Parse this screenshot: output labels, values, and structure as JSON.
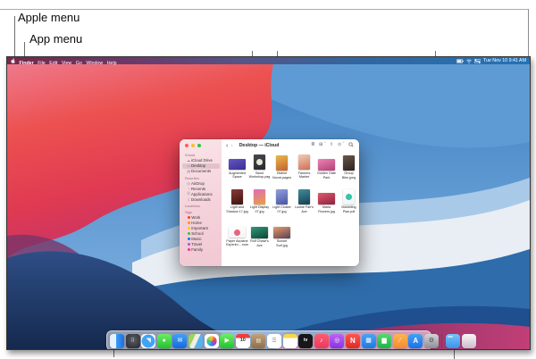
{
  "figure": {
    "labels": [
      {
        "id": "apple-menu",
        "text": "Apple menu"
      },
      {
        "id": "app-menu",
        "text": "App menu"
      }
    ]
  },
  "menu_bar": {
    "app_menus": [
      "Finder",
      "File",
      "Edit",
      "View",
      "Go",
      "Window",
      "Help"
    ],
    "status": {
      "icons": [
        "battery-icon",
        "wifi-icon",
        "control-center-icon"
      ],
      "datetime": "Tue Nov 10  9:41 AM"
    }
  },
  "finder_window": {
    "title": "Desktop — iCloud",
    "toolbar": {
      "back": "‹",
      "forward": "›",
      "icons": [
        {
          "name": "view-icon",
          "glyph": "≣"
        },
        {
          "name": "group-icon",
          "glyph": "⊞ ˇ"
        },
        {
          "name": "share-icon",
          "glyph": "⇧"
        },
        {
          "name": "more-icon",
          "glyph": "⊙ ˇ"
        },
        {
          "name": "search-icon",
          "glyph": "svg"
        }
      ]
    },
    "sidebar": {
      "sections": [
        {
          "header": "iCloud",
          "items": [
            {
              "label": "iCloud Drive",
              "icon": "cloud-icon"
            },
            {
              "label": "Desktop",
              "icon": "desktop-icon",
              "selected": true
            },
            {
              "label": "Documents",
              "icon": "documents-icon"
            }
          ]
        },
        {
          "header": "Favorites",
          "items": [
            {
              "label": "AirDrop",
              "icon": "airdrop-icon"
            },
            {
              "label": "Recents",
              "icon": "recents-icon"
            },
            {
              "label": "Applications",
              "icon": "applications-icon"
            },
            {
              "label": "Downloads",
              "icon": "downloads-icon"
            }
          ]
        },
        {
          "header": "Locations",
          "items": []
        },
        {
          "header": "Tags",
          "items": [
            {
              "label": "Work",
              "dot": "#ff3b30"
            },
            {
              "label": "Home",
              "dot": "#ff9500"
            },
            {
              "label": "Important",
              "dot": "#ffcc00"
            },
            {
              "label": "School",
              "dot": "#28c840"
            },
            {
              "label": "Music",
              "dot": "#007aff"
            },
            {
              "label": "Travel",
              "dot": "#af52de"
            },
            {
              "label": "Family",
              "dot": "#ff2d92"
            }
          ]
        }
      ]
    },
    "files": [
      {
        "name": "Augmented Space Reimagined.key",
        "thumb": {
          "o": "l",
          "c1": "#6456c8",
          "c2": "#3b2f8e"
        }
      },
      {
        "name": "Band Workshop.pages",
        "thumb": {
          "o": "p",
          "c1": "#4a4a4e",
          "c2": "#28282c",
          "accent": "#e9e5da"
        }
      },
      {
        "name": "District Noord.pages",
        "thumb": {
          "o": "p",
          "c1": "#e8b84a",
          "c2": "#c2622e"
        }
      },
      {
        "name": "Farmers Market Monthly Planner.pdf",
        "thumb": {
          "o": "p",
          "c1": "#f0cdb8",
          "c2": "#cf6f52"
        }
      },
      {
        "name": "Golden Gate Park",
        "thumb": {
          "o": "l",
          "c1": "#ef82b4",
          "c2": "#b04277"
        }
      },
      {
        "name": "Group Bike.jpeg",
        "thumb": {
          "o": "p",
          "c1": "#6a5648",
          "c2": "#2e241e"
        }
      },
      {
        "name": "Light and Shadow 17.jpg",
        "thumb": {
          "o": "p",
          "c1": "#8a3a34",
          "c2": "#3a1512"
        }
      },
      {
        "name": "Light Display 07.jpg",
        "thumb": {
          "o": "p",
          "c1": "#e06ac0",
          "c2": "#e8a23a"
        }
      },
      {
        "name": "Light Cluster 07.jpg",
        "thumb": {
          "o": "p",
          "c1": "#8fa0dc",
          "c2": "#4a55a2"
        }
      },
      {
        "name": "Louise Fair's Ave",
        "thumb": {
          "o": "p",
          "c1": "#3f8ea0",
          "c2": "#173f4e"
        }
      },
      {
        "name": "Maria Flowers.jpg",
        "thumb": {
          "o": "l",
          "c1": "#e05a6a",
          "c2": "#8e2242"
        }
      },
      {
        "name": "Marketing Plan.pdf",
        "thumb": {
          "o": "p",
          "c1": "#ffffff",
          "c2": "#eef4f2",
          "accent": "#35c4a8"
        }
      },
      {
        "name": "Paper Airplane Experim....numbers",
        "thumb": {
          "o": "l",
          "c1": "#ffffff",
          "c2": "#f4f4f4",
          "accent": "#e8647e"
        }
      },
      {
        "name": "Rolf Chase's Ave",
        "thumb": {
          "o": "l",
          "c1": "#2f9a7a",
          "c2": "#114436"
        }
      },
      {
        "name": "Sunset Surf.jpg",
        "thumb": {
          "o": "l",
          "c1": "#e89a66",
          "c2": "#584058"
        }
      }
    ]
  },
  "dock": {
    "apps": [
      {
        "id": "finder",
        "name": "Finder",
        "bg": "linear-gradient(90deg,#e3f2fc 0%,#e3f2fc 44%,#3f9bf4 44%,#1b6fe0 100%)",
        "glyph": "",
        "fg": "#1b5fb0"
      },
      {
        "id": "launchpad",
        "name": "Launchpad",
        "bg": "radial-gradient(circle at 50% 40%,#5d5d66,#26262c)",
        "glyph": "⠿",
        "fg": "#d2d5de"
      },
      {
        "id": "safari",
        "name": "Safari",
        "bg": "radial-gradient(circle at 50% 50%,#3fa4f6 0%,#3fa4f6 64%,#f3f5f8 66%)",
        "glyph": "◥",
        "fg": "#f2f2f4"
      },
      {
        "id": "messages",
        "name": "Messages",
        "bg": "linear-gradient(180deg,#6ced63,#20c32f)",
        "glyph": "●",
        "fg": "#ffffff"
      },
      {
        "id": "mail",
        "name": "Mail",
        "bg": "linear-gradient(180deg,#41a1f5,#1468df)",
        "glyph": "✉",
        "fg": "#ffffff"
      },
      {
        "id": "maps",
        "name": "Maps",
        "bg": "linear-gradient(115deg,#9bd45f 0%,#9bd45f 34%,#f1eee2 34%,#f1eee2 58%,#57b1f1 58%)",
        "glyph": "",
        "fg": "#ffffff"
      },
      {
        "id": "photos",
        "name": "Photos",
        "bg": "radial-gradient(circle closest-side,rgba(255,255,255,0) 0%,rgba(255,255,255,0) 70%,#ffffff 72%),conic-gradient(#f6c23d,#f0643c,#cf3e84,#8e52d0,#3f77e8,#39b5e8,#43c26f,#a6d23f,#f6c23d)",
        "glyph": "",
        "fg": "#ffffff"
      },
      {
        "id": "facetime",
        "name": "FaceTime",
        "bg": "linear-gradient(180deg,#6ced63,#20c32f)",
        "glyph": "▶",
        "fg": "#ffffff"
      },
      {
        "id": "calendar",
        "name": "Calendar",
        "bg": "linear-gradient(180deg,#f23c3c 0%,#f23c3c 27%,#ffffff 27%)",
        "glyph": "10",
        "fg": "#333333"
      },
      {
        "id": "contacts",
        "name": "Contacts",
        "bg": "linear-gradient(180deg,#c3a077,#8c6f4e)",
        "glyph": "▤",
        "fg": "#f3e9d6"
      },
      {
        "id": "reminders",
        "name": "Reminders",
        "bg": "#ffffff",
        "glyph": "☰",
        "fg": "#8a8a90"
      },
      {
        "id": "notes",
        "name": "Notes",
        "bg": "linear-gradient(180deg,#f7d64a 0%,#f7d64a 28%,#ffffff 28%)",
        "glyph": "",
        "fg": "#999999"
      },
      {
        "id": "tv",
        "name": "TV",
        "bg": "#17171a",
        "glyph": "tv",
        "fg": "#ffffff"
      },
      {
        "id": "music",
        "name": "Music",
        "bg": "linear-gradient(180deg,#fc5c72,#ec3860)",
        "glyph": "♪",
        "fg": "#ffffff"
      },
      {
        "id": "podcasts",
        "name": "Podcasts",
        "bg": "linear-gradient(180deg,#c061f2,#8434e8)",
        "glyph": "◎",
        "fg": "#ffffff"
      },
      {
        "id": "news",
        "name": "News",
        "bg": "linear-gradient(180deg,#ff544c,#e02a24)",
        "glyph": "N",
        "fg": "#ffffff"
      },
      {
        "id": "keynote",
        "name": "Keynote",
        "bg": "linear-gradient(180deg,#4aa3f5,#1d79e4)",
        "glyph": "▦",
        "fg": "#ffffff"
      },
      {
        "id": "numbers",
        "name": "Numbers",
        "bg": "linear-gradient(180deg,#55d96c,#1fb14c)",
        "glyph": "▆",
        "fg": "#ffffff"
      },
      {
        "id": "pages",
        "name": "Pages",
        "bg": "linear-gradient(180deg,#ffb54d,#f28a30)",
        "glyph": "∕",
        "fg": "#ffffff"
      },
      {
        "id": "appstore",
        "name": "App Store",
        "bg": "linear-gradient(180deg,#40a2f6,#1a71e8)",
        "glyph": "A",
        "fg": "#ffffff"
      },
      {
        "id": "system-preferences",
        "name": "System Preferences",
        "bg": "linear-gradient(180deg,#d4d4d8,#8e8e96)",
        "glyph": "⚙",
        "fg": "#48484e"
      }
    ],
    "downloads_folder": {
      "id": "downloads-folder",
      "name": "Downloads",
      "bg": "linear-gradient(180deg,#73c4f8,#3b93ea)"
    },
    "trash": {
      "id": "trash",
      "name": "Trash",
      "bg": "linear-gradient(180deg,rgba(255,255,255,.95),rgba(208,210,218,.85))"
    }
  },
  "colors": {
    "menu_bar_left": "#76284a",
    "menu_bar_right": "#2472b6",
    "wallpaper_red": "#e84548",
    "wallpaper_pink": "#ef7d92",
    "wallpaper_blue": "#3e80c2",
    "wallpaper_white_wave": "#e9eef4",
    "wallpaper_navy": "#15294e",
    "wallpaper_magenta": "#c13f76",
    "sidebar_tint": "#f5d2da",
    "traffic_red": "#ff5f57",
    "traffic_yellow": "#febc2e",
    "traffic_green": "#28c840"
  }
}
